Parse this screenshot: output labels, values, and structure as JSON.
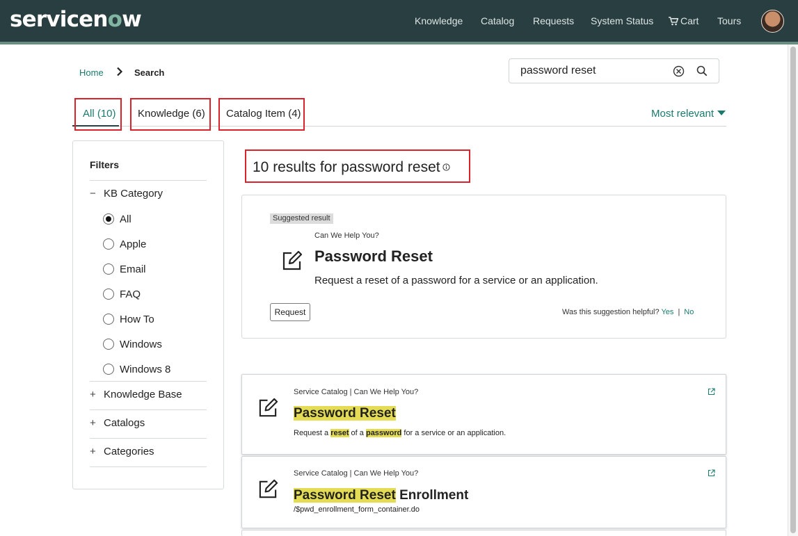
{
  "header": {
    "logo_pre": "servicen",
    "logo_o": "o",
    "logo_post": "w",
    "nav": [
      {
        "label": "Knowledge"
      },
      {
        "label": "Catalog"
      },
      {
        "label": "Requests"
      },
      {
        "label": "System Status"
      },
      {
        "label": "Cart",
        "icon": "cart-icon"
      },
      {
        "label": "Tours"
      }
    ],
    "brand_color": "#293e40",
    "accent_color": "#1a7a6e"
  },
  "breadcrumb": {
    "home": "Home",
    "current": "Search"
  },
  "search": {
    "value": "password reset",
    "clear_icon": "clear-circle-icon",
    "submit_icon": "search-icon"
  },
  "tabs": [
    {
      "label": "All (10)",
      "active": true
    },
    {
      "label": "Knowledge (6)"
    },
    {
      "label": "Catalog Item (4)"
    }
  ],
  "sort": {
    "label": "Most relevant"
  },
  "filters": {
    "title": "Filters",
    "kb_category": {
      "label": "KB Category",
      "expanded": true,
      "options": [
        "All",
        "Apple",
        "Email",
        "FAQ",
        "How To",
        "Windows",
        "Windows 8"
      ],
      "selected": "All"
    },
    "collapsed_sections": [
      "Knowledge Base",
      "Catalogs",
      "Categories"
    ]
  },
  "results_heading": "10 results for password reset",
  "suggested": {
    "badge": "Suggested result",
    "source": "Can We Help You?",
    "title": "Password Reset",
    "description": "Request a reset of a password for a service or an application.",
    "button": "Request",
    "helpful_q": "Was this suggestion helpful?",
    "yes": "Yes",
    "sep": "|",
    "no": "No"
  },
  "results": [
    {
      "source_a": "Service Catalog",
      "source_b": "Can We Help You?",
      "title_hl": "Password Reset",
      "title_rest": "",
      "desc_parts": [
        "Request a ",
        "reset",
        " of a ",
        "password",
        " for a service or an application."
      ]
    },
    {
      "source_a": "Service Catalog",
      "source_b": "Can We Help You?",
      "title_hl": "Password Reset",
      "title_rest": " Enrollment",
      "desc": "/$pwd_enrollment_form_container.do"
    }
  ]
}
